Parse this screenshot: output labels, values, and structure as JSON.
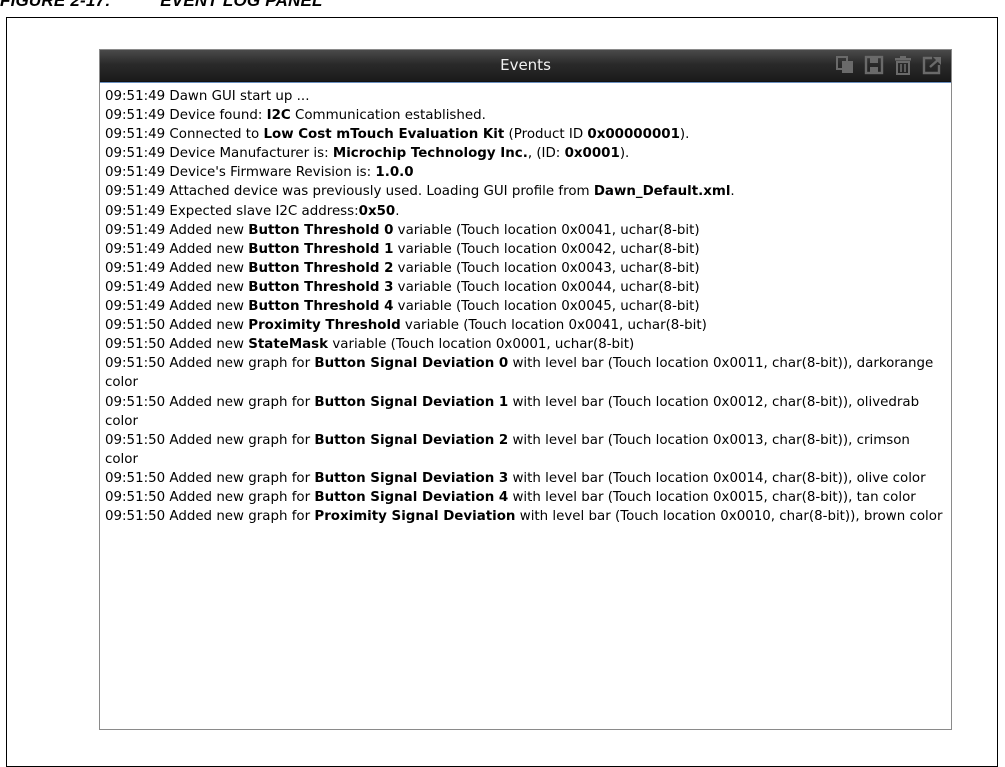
{
  "figure": {
    "caption": "FIGURE 2-17:          EVENT LOG PANEL"
  },
  "panel": {
    "title": "Events",
    "toolbar": [
      {
        "icon": "copy-icon"
      },
      {
        "icon": "save-icon"
      },
      {
        "icon": "trash-icon"
      },
      {
        "icon": "popout-icon"
      }
    ]
  },
  "colors": {
    "titlebar": "#2a2a2a",
    "title_text": "#f2f2f2",
    "icon": "#6a6a6a",
    "log_border": "#6a8fbf"
  },
  "log": [
    [
      {
        "t": "09:51:49 Dawn GUI start up ..."
      }
    ],
    [
      {
        "t": "09:51:49 Device found: "
      },
      {
        "t": "I2C",
        "b": true
      },
      {
        "t": " Communication established."
      }
    ],
    [
      {
        "t": "09:51:49 Connected to "
      },
      {
        "t": "Low Cost mTouch Evaluation Kit",
        "b": true
      },
      {
        "t": " (Product ID "
      },
      {
        "t": "0x00000001",
        "b": true
      },
      {
        "t": ")."
      }
    ],
    [
      {
        "t": "09:51:49 Device Manufacturer is: "
      },
      {
        "t": "Microchip Technology Inc.",
        "b": true
      },
      {
        "t": ", (ID: "
      },
      {
        "t": "0x0001",
        "b": true
      },
      {
        "t": ")."
      }
    ],
    [
      {
        "t": "09:51:49 Device's Firmware Revision is: "
      },
      {
        "t": "1.0.0",
        "b": true
      }
    ],
    [
      {
        "t": "09:51:49 Attached device was previously used. Loading GUI profile from "
      },
      {
        "t": "Dawn_Default.xml",
        "b": true
      },
      {
        "t": "."
      }
    ],
    [
      {
        "t": "09:51:49 Expected slave I2C address:"
      },
      {
        "t": "0x50",
        "b": true
      },
      {
        "t": "."
      }
    ],
    [
      {
        "t": "09:51:49 Added new "
      },
      {
        "t": "Button Threshold 0",
        "b": true
      },
      {
        "t": " variable (Touch location 0x0041, uchar(8-bit)"
      }
    ],
    [
      {
        "t": "09:51:49 Added new "
      },
      {
        "t": "Button Threshold 1",
        "b": true
      },
      {
        "t": " variable (Touch location 0x0042, uchar(8-bit)"
      }
    ],
    [
      {
        "t": "09:51:49 Added new "
      },
      {
        "t": "Button Threshold 2",
        "b": true
      },
      {
        "t": " variable (Touch location 0x0043, uchar(8-bit)"
      }
    ],
    [
      {
        "t": "09:51:49 Added new "
      },
      {
        "t": "Button Threshold 3",
        "b": true
      },
      {
        "t": " variable (Touch location 0x0044, uchar(8-bit)"
      }
    ],
    [
      {
        "t": "09:51:49 Added new "
      },
      {
        "t": "Button Threshold 4",
        "b": true
      },
      {
        "t": " variable (Touch location 0x0045, uchar(8-bit)"
      }
    ],
    [
      {
        "t": "09:51:50 Added new "
      },
      {
        "t": "Proximity Threshold",
        "b": true
      },
      {
        "t": " variable (Touch location 0x0041, uchar(8-bit)"
      }
    ],
    [
      {
        "t": "09:51:50 Added new "
      },
      {
        "t": "StateMask",
        "b": true
      },
      {
        "t": " variable (Touch location 0x0001, uchar(8-bit)"
      }
    ],
    [
      {
        "t": "09:51:50 Added new graph for "
      },
      {
        "t": "Button Signal Deviation 0",
        "b": true
      },
      {
        "t": " with level bar (Touch location 0x0011, char(8-bit)), darkorange color"
      }
    ],
    [
      {
        "t": "09:51:50 Added new graph for "
      },
      {
        "t": "Button Signal Deviation 1",
        "b": true
      },
      {
        "t": " with level bar (Touch location 0x0012, char(8-bit)), olivedrab color"
      }
    ],
    [
      {
        "t": "09:51:50 Added new graph for "
      },
      {
        "t": "Button Signal Deviation 2",
        "b": true
      },
      {
        "t": " with level bar (Touch location 0x0013, char(8-bit)), crimson color"
      }
    ],
    [
      {
        "t": "09:51:50 Added new graph for "
      },
      {
        "t": "Button Signal Deviation 3",
        "b": true
      },
      {
        "t": " with level bar (Touch location 0x0014, char(8-bit)), olive color"
      }
    ],
    [
      {
        "t": "09:51:50 Added new graph for "
      },
      {
        "t": "Button Signal Deviation 4",
        "b": true
      },
      {
        "t": " with level bar (Touch location 0x0015, char(8-bit)), tan color"
      }
    ],
    [
      {
        "t": "09:51:50 Added new graph for "
      },
      {
        "t": "Proximity Signal Deviation",
        "b": true
      },
      {
        "t": " with level bar (Touch location 0x0010, char(8-bit)), brown color"
      }
    ]
  ]
}
